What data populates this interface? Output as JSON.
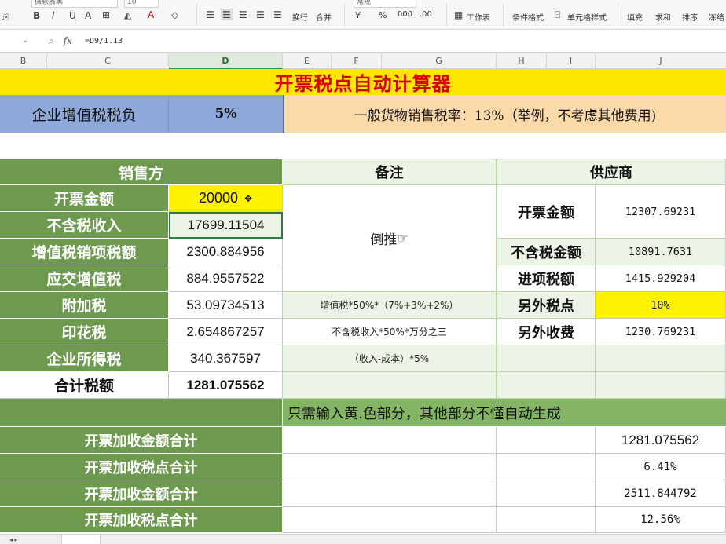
{
  "ribbon": {
    "font_name": "微软雅黑",
    "font_size": "10",
    "wrap_label": "换行",
    "merge_label": "合并",
    "number_format": "常规",
    "currency_symbol": "¥",
    "percent_symbol": "%",
    "worksheet_label": "工作表",
    "cond_format_label": "条件格式",
    "cell_style_label": "单元格样式",
    "fill_label": "填充",
    "sum_label": "求和",
    "sort_label": "排序",
    "freeze_label": "冻结"
  },
  "formula_bar": {
    "fx_label": "fx",
    "formula": "=D9/1.13"
  },
  "columns": [
    "B",
    "C",
    "D",
    "E",
    "F",
    "G",
    "H",
    "I",
    "J"
  ],
  "active_column": "D",
  "sheet": {
    "title": "开票税点自动计算器",
    "burden_label": "企业增值税税负",
    "burden_value": "5%",
    "tax_rate_note": "一般货物销售税率：13%（举例，不考虑其他费用)",
    "seller": {
      "header": "销售方",
      "rows": [
        {
          "label": "开票金额",
          "value": "20000"
        },
        {
          "label": "不含税收入",
          "value": "17699.11504"
        },
        {
          "label": "增值税销项税额",
          "value": "2300.884956"
        },
        {
          "label": "应交增值税",
          "value": "884.9557522"
        },
        {
          "label": "附加税",
          "value": "53.09734513"
        },
        {
          "label": "印花税",
          "value": "2.654867257"
        },
        {
          "label": "企业所得税",
          "value": "340.367597"
        },
        {
          "label": "合计税额",
          "value": "1281.075562"
        }
      ]
    },
    "remarks": {
      "header": "备注",
      "reverse_calc": "倒推",
      "surtax_note": "增值税*50%*（7%+3%+2%）",
      "stamp_note": "不含税收入*50%*万分之三",
      "income_tax_note": "（收入-成本）*5%"
    },
    "supplier": {
      "header": "供应商",
      "invoice_label": "开票金额",
      "invoice_value": "12307.69231",
      "net_label": "不含税金额",
      "net_value": "10891.7631",
      "input_tax_label": "进项税额",
      "input_tax_value": "1415.929204",
      "extra_rate_label": "另外税点",
      "extra_rate_value": "10%",
      "extra_fee_label": "另外收费",
      "extra_fee_value": "1230.769231"
    },
    "input_hint": "只需输入黄.色部分，其他部分不懂自动生成",
    "summary": [
      {
        "label": "开票加收金额合计",
        "value": "1281.075562"
      },
      {
        "label": "开票加收税点合计",
        "value": "6.41%"
      },
      {
        "label": "开票加收金额合计",
        "value": "2511.844792"
      },
      {
        "label": "开票加收税点合计",
        "value": "12.56%"
      }
    ]
  },
  "colors": {
    "header_green": "#6e9a50",
    "highlight_yellow": "#fff200",
    "title_red": "#d40000",
    "burden_blue": "#8ea9d9",
    "note_peach": "#fbd9a8"
  }
}
